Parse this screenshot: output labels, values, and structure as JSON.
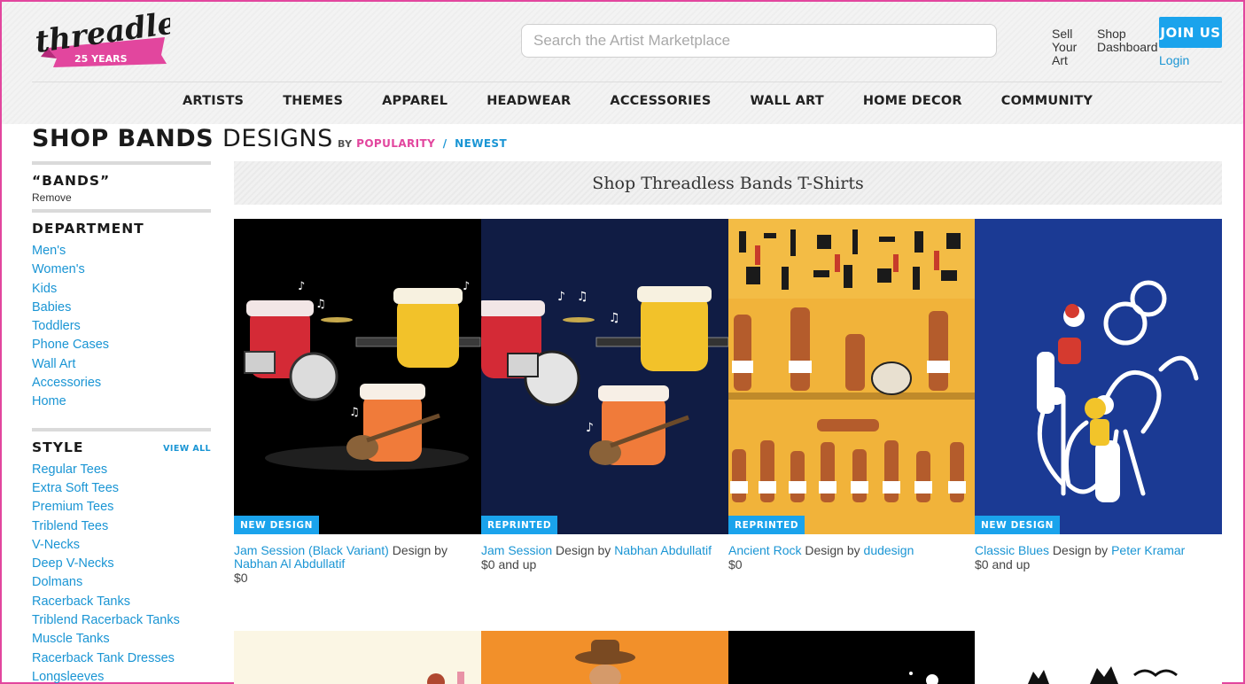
{
  "header": {
    "logo_text": "threadless",
    "logo_sub": "25 YEARS",
    "search_placeholder": "Search the Artist Marketplace",
    "sell_label": "Sell Your Art",
    "shop_label": "Shop Dashboard",
    "join_label": "JOIN US",
    "login_label": "Login"
  },
  "nav": [
    "ARTISTS",
    "THEMES",
    "APPAREL",
    "HEADWEAR",
    "ACCESSORIES",
    "WALL ART",
    "HOME DECOR",
    "COMMUNITY"
  ],
  "title": {
    "bold": "SHOP BANDS",
    "light": "DESIGNS",
    "by": "BY",
    "popularity": "POPULARITY",
    "slash": "/",
    "newest": "NEWEST"
  },
  "sidebar": {
    "filter_title": "“BANDS”",
    "remove_label": "Remove",
    "department_title": "DEPARTMENT",
    "departments": [
      "Men's",
      "Women's",
      "Kids",
      "Babies",
      "Toddlers",
      "Phone Cases",
      "Wall Art",
      "Accessories",
      "Home"
    ],
    "style_title": "STYLE",
    "view_all": "VIEW ALL",
    "styles": [
      "Regular Tees",
      "Extra Soft Tees",
      "Premium Tees",
      "Triblend Tees",
      "V-Necks",
      "Deep V-Necks",
      "Dolmans",
      "Racerback Tanks",
      "Triblend Racerback Tanks",
      "Muscle Tanks",
      "Racerback Tank Dresses",
      "Longsleeves"
    ]
  },
  "banner": "Shop Threadless Bands T-Shirts",
  "products": [
    {
      "badge": "NEW DESIGN",
      "title": "Jam Session (Black Variant)",
      "design_by": "Design by",
      "artist": "Nabhan Al Abdullatif",
      "price": "$0",
      "bg": "#000000"
    },
    {
      "badge": "REPRINTED",
      "title": "Jam Session",
      "design_by": "Design by",
      "artist": "Nabhan Abdullatif",
      "price": "$0 and up",
      "bg": "#101c44"
    },
    {
      "badge": "REPRINTED",
      "title": "Ancient Rock",
      "design_by": "Design by",
      "artist": "dudesign",
      "price": "$0",
      "bg": "#f1b33a"
    },
    {
      "badge": "NEW DESIGN",
      "title": "Classic Blues",
      "design_by": "Design by",
      "artist": "Peter Kramar",
      "price": "$0 and up",
      "bg": "#1b3a94"
    }
  ],
  "colors": {
    "accent": "#1aa3ec",
    "pink": "#e2469e",
    "link": "#1a95d4"
  }
}
